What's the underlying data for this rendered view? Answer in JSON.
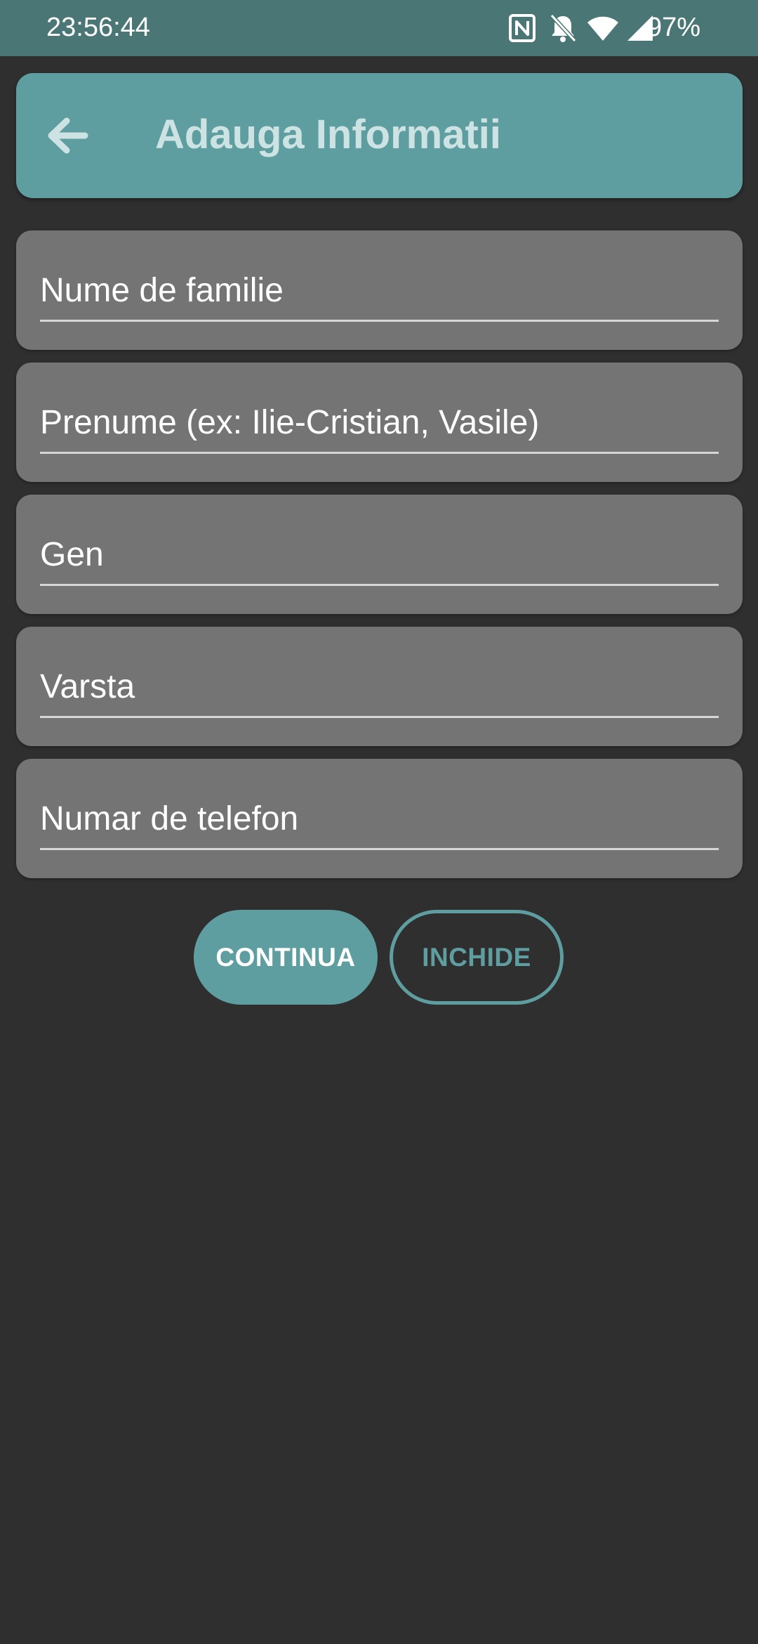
{
  "status_bar": {
    "time": "23:56:44",
    "battery": "97%",
    "icons": [
      "nfc-icon",
      "notifications-off-icon",
      "wifi-icon",
      "signal-icon"
    ]
  },
  "app_bar": {
    "back_icon": "arrow-back-icon",
    "title": "Adauga Informatii"
  },
  "form": {
    "fields": [
      {
        "placeholder": "Nume de familie",
        "value": ""
      },
      {
        "placeholder": "Prenume (ex: Ilie-Cristian, Vasile)",
        "value": ""
      },
      {
        "placeholder": "Gen",
        "value": ""
      },
      {
        "placeholder": "Varsta",
        "value": ""
      },
      {
        "placeholder": "Numar de telefon",
        "value": ""
      }
    ]
  },
  "actions": {
    "continue_label": "CONTINUA",
    "close_label": "INCHIDE"
  },
  "colors": {
    "status_bar": "#4a7776",
    "accent": "#5f9ea0",
    "background": "#2f2f2f",
    "card": "#747474"
  }
}
